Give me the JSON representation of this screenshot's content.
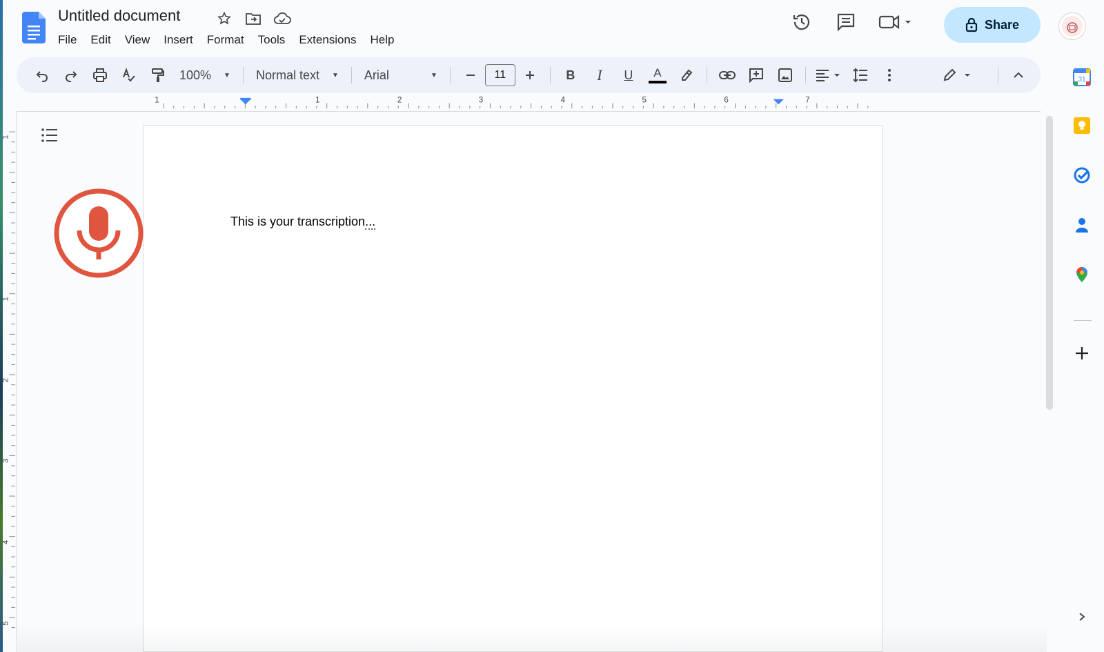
{
  "app": {
    "title": "Untitled document",
    "accent": "#c2e7ff",
    "brand": "#4285f4"
  },
  "menu": [
    "File",
    "Edit",
    "View",
    "Insert",
    "Format",
    "Tools",
    "Extensions",
    "Help"
  ],
  "header": {
    "share_label": "Share"
  },
  "toolbar": {
    "zoom": "100%",
    "style": "Normal text",
    "font": "Arial",
    "font_size": "11",
    "bold": "B",
    "italic": "I",
    "underline": "U",
    "text_color": "A"
  },
  "ruler": {
    "h_labels": [
      "1",
      "1",
      "2",
      "3",
      "4",
      "5",
      "6",
      "7"
    ],
    "v_labels": [
      "1",
      "1",
      "2",
      "3",
      "4",
      "5"
    ]
  },
  "document": {
    "text": "This is your transcription",
    "trailing": "..."
  },
  "side_panel": {
    "calendar_day": "31",
    "icons": [
      "calendar-icon",
      "keep-icon",
      "tasks-icon",
      "contacts-icon",
      "maps-icon",
      "add-icon"
    ]
  },
  "colors": {
    "mic": "#e0553f",
    "toolbar_bg": "#edf2fa",
    "page_bg": "#f9fbfd"
  }
}
